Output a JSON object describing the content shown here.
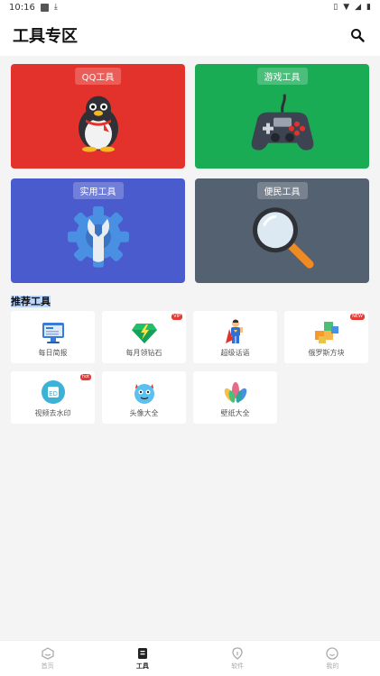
{
  "status_bar": {
    "time": "10:16",
    "icons": [
      "gallery-icon",
      "download-icon",
      "vibrate-icon",
      "wifi-icon",
      "signal-icon",
      "battery-icon"
    ]
  },
  "header": {
    "title": "工具专区",
    "search_icon": "search-icon"
  },
  "categories": [
    {
      "label": "QQ工具",
      "color": "#e3312b",
      "icon": "penguin-icon"
    },
    {
      "label": "游戏工具",
      "color": "#1aab55",
      "icon": "gamepad-icon"
    },
    {
      "label": "实用工具",
      "color": "#4a5bce",
      "icon": "gear-wrench-icon"
    },
    {
      "label": "便民工具",
      "color": "#536170",
      "icon": "magnifier-icon"
    }
  ],
  "recommended": {
    "title": "推荐工具",
    "items": [
      {
        "label": "每日简报",
        "icon": "news-monitor-icon",
        "badge": ""
      },
      {
        "label": "每月领钻石",
        "icon": "diamond-icon",
        "badge": "VIP"
      },
      {
        "label": "超级话语",
        "icon": "superhero-icon",
        "badge": ""
      },
      {
        "label": "俄罗斯方块",
        "icon": "blocks-icon",
        "badge": "NEW"
      },
      {
        "label": "视频去水印",
        "icon": "video-watermark-icon",
        "badge": "hot"
      },
      {
        "label": "头像大全",
        "icon": "avatar-monster-icon",
        "badge": ""
      },
      {
        "label": "壁纸大全",
        "icon": "wallpaper-flower-icon",
        "badge": ""
      }
    ]
  },
  "tabs": [
    {
      "label": "首页",
      "icon": "home-icon",
      "active": false
    },
    {
      "label": "工具",
      "icon": "tools-icon",
      "active": true
    },
    {
      "label": "软件",
      "icon": "software-icon",
      "active": false
    },
    {
      "label": "我的",
      "icon": "profile-icon",
      "active": false
    }
  ]
}
